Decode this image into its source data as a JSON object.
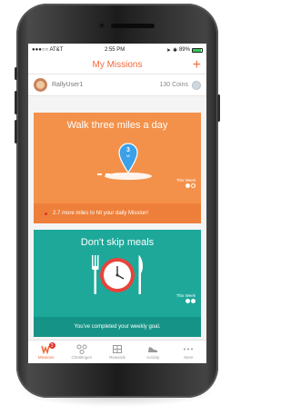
{
  "status": {
    "carrier": "●●●○○ AT&T",
    "time": "2:55 PM",
    "battery": "89%"
  },
  "nav": {
    "title": "My Missions",
    "add_symbol": "+"
  },
  "user": {
    "name": "RallyUser1",
    "coins": "130 Coins"
  },
  "missions": [
    {
      "title": "Walk three miles a day",
      "marker_value": "3",
      "marker_unit": "MI",
      "week_label": "This Week",
      "week_progress": [
        1,
        0
      ],
      "message": "2.7 more miles to hit your daily Mission!",
      "color": "#f3914a"
    },
    {
      "title": "Don't skip meals",
      "week_label": "This Week",
      "week_progress": [
        1,
        1
      ],
      "message": "You've completed your weekly goal.",
      "color": "#1ea89a"
    }
  ],
  "tabs": [
    {
      "label": "Missions",
      "icon": "missions-icon",
      "badge": "3",
      "active": true
    },
    {
      "label": "Challenges",
      "icon": "challenges-icon"
    },
    {
      "label": "Rewards",
      "icon": "rewards-icon"
    },
    {
      "label": "Activity",
      "icon": "activity-shoe-icon"
    },
    {
      "label": "More",
      "icon": "more-icon"
    }
  ],
  "colors": {
    "accent": "#f26a3a",
    "card_orange": "#f3914a",
    "card_teal": "#1ea89a"
  }
}
